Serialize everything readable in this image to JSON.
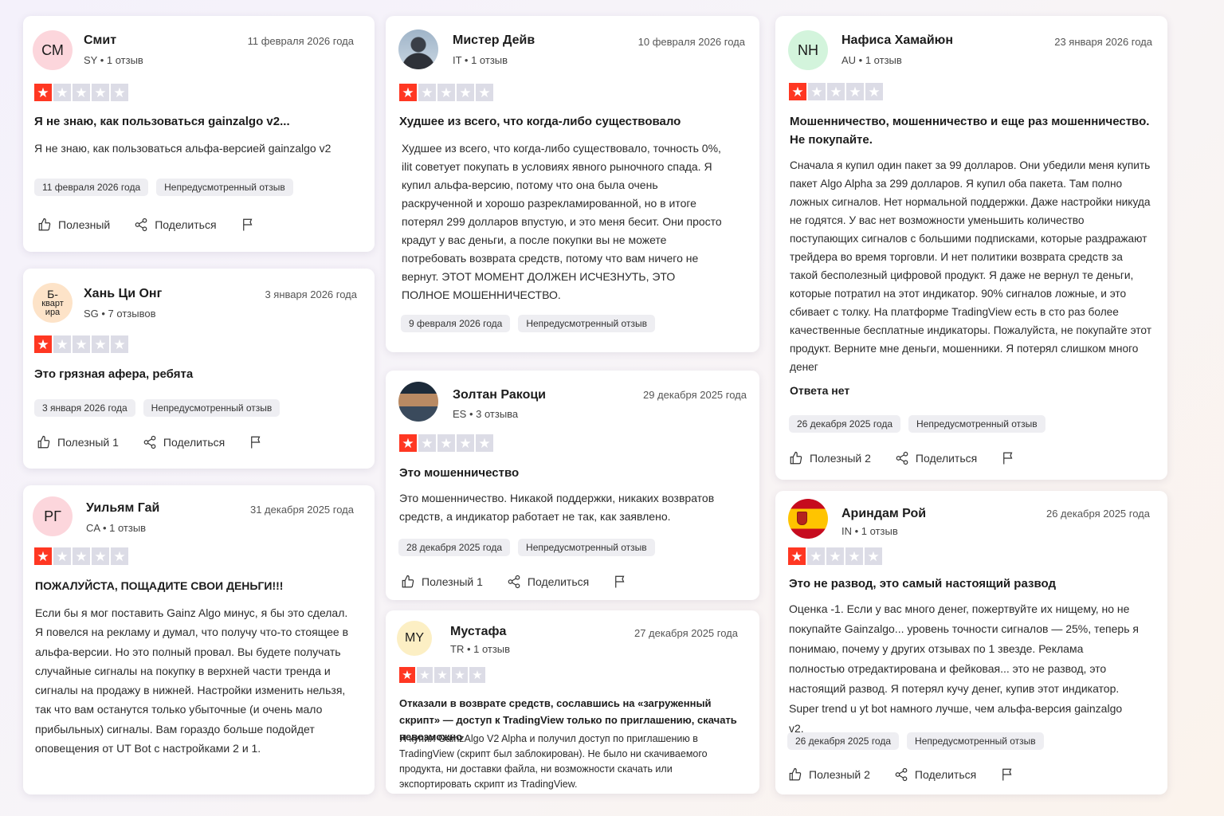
{
  "common": {
    "helpful_label": "Полезный",
    "share_label": "Поделиться",
    "unprompted_tag": "Непредусмотренный отзыв"
  },
  "colors": {
    "star_on": "#ff3722",
    "star_off": "#dcdce6"
  },
  "reviews": [
    {
      "initials": "СМ",
      "name": "Смит",
      "meta": "SY • 1 отзыв",
      "date": "11 февраля 2026 года",
      "rating": 1,
      "title": "Я не знаю, как пользоваться gainzalgo v2...",
      "body": "Я не знаю, как пользоваться альфа-версией gainzalgo v2",
      "tag_date": "11 февраля 2026 года",
      "helpful": "Полезный"
    },
    {
      "initials": "Б-кварт ира",
      "initials_lines": [
        "Б-",
        "кварт",
        "ира"
      ],
      "name": "Хань Ци Онг",
      "meta": "SG • 7 отзывов",
      "date": "3 января 2026 года",
      "rating": 1,
      "title": "Это грязная афера, ребята",
      "body": "",
      "tag_date": "3 января 2026 года",
      "helpful": "Полезный 1"
    },
    {
      "initials": "РГ",
      "name": "Уильям Гай",
      "meta": "CA • 1 отзыв",
      "date": "31 декабря 2025 года",
      "rating": 1,
      "title": "ПОЖАЛУЙСТА, ПОЩАДИТЕ СВОИ ДЕНЬГИ!!!",
      "body": "Если бы я мог поставить Gainz Algo минус, я бы это сделал. Я повелся на рекламу и думал, что получу что-то стоящее в альфа-версии. Но это полный провал. Вы будете получать случайные сигналы на покупку в верхней части тренда и сигналы на продажу в нижней. Настройки изменить нельзя, так что вам останутся только убыточные (и очень мало прибыльных) сигналы. Вам гораздо больше подойдет оповещения от UT Bot с настройками 2 и 1."
    },
    {
      "avatar": "photo-avatar",
      "name": "Мистер Дейв",
      "meta": "IT • 1 отзыв",
      "date": "10 февраля 2026 года",
      "rating": 1,
      "title": "Худшее из всего, что когда-либо существовало",
      "body": "Худшее из всего, что когда-либо существовало, точность 0%, ilit советует покупать в условиях явного рыночного спада. Я купил альфа-версию, потому что она была очень раскрученной и хорошо разрекламированной, но в итоге потерял 299 долларов впустую, и это меня бесит. Они просто крадут у вас деньги, а после покупки вы не можете потребовать возврата средств, потому что вам ничего не вернут. ЭТОТ МОМЕНТ ДОЛЖЕН ИСЧЕЗНУТЬ, ЭТО ПОЛНОЕ МОШЕННИЧЕСТВО.",
      "tag_date": "9 февраля 2026 года"
    },
    {
      "avatar": "photo-avatar",
      "name": "Золтан Ракоци",
      "meta": "ES • 3 отзыва",
      "date": "29 декабря 2025 года",
      "rating": 1,
      "title": "Это мошенничество",
      "body": "Это мошенничество. Никакой поддержки, никаких возвратов средств, а индикатор работает не так, как заявлено.",
      "tag_date": "28 декабря 2025 года",
      "helpful": "Полезный 1"
    },
    {
      "initials": "MY",
      "name": "Мустафа",
      "meta": "TR • 1 отзыв",
      "date": "27 декабря 2025 года",
      "rating": 1,
      "title": "Отказали в возврате средств, сославшись на «загруженный скрипт» — доступ к TradingView только по приглашению, скачать невозможно",
      "body": "Я купил GainzAlgo V2 Alpha и получил доступ по приглашению в TradingView (скрипт был заблокирован). Не было ни скачиваемого продукта, ни доставки файла, ни возможности скачать или экспортировать скрипт из TradingView."
    },
    {
      "initials": "NH",
      "name": "Нафиса Хамайюн",
      "meta": "AU • 1 отзыв",
      "date": "23 января 2026 года",
      "rating": 1,
      "title": "Мошенничество, мошенничество и еще раз мошенничество. Не покупайте.",
      "body": "Сначала я купил один пакет за 99 долларов. Они убедили меня купить пакет Algo Alpha за 299 долларов. Я купил оба пакета. Там полно ложных сигналов. Нет нормальной поддержки. Даже настройки никуда не годятся. У вас нет возможности уменьшить количество поступающих сигналов с большими подписками, которые раздражают трейдера во время торговли. И нет политики возврата средств за такой бесполезный цифровой продукт. Я даже не вернул те деньги, которые потратил на этот индикатор. 90% сигналов ложные, и это сбивает с толку. На платформе TradingView есть в сто раз более качественные бесплатные индикаторы. Пожалуйста, не покупайте этот продукт. Верните мне деньги, мошенники. Я потерял слишком много денег",
      "no_reply": "Ответа нет",
      "tag_date": "26 декабря 2025 года",
      "helpful": "Полезный 2"
    },
    {
      "avatar": "spain-flag-avatar",
      "name": "Ариндам Рой",
      "meta": "IN • 1 отзыв",
      "date": "26 декабря 2025 года",
      "rating": 1,
      "title": "Это не развод, это самый настоящий развод",
      "body": "Оценка -1. Если у вас много денег, пожертвуйте их нищему, но не покупайте Gainzalgo... уровень точности сигналов — 25%, теперь я понимаю, почему у других отзывах по 1 звезде. Реклама полностью отредактирована и фейковая... это не развод, это настоящий развод. Я потерял кучу денег, купив этот индикатор. Super trend u yt bot намного лучше, чем альфа-версия gainzalgo v2.",
      "tag_date": "26 декабря 2025 года",
      "helpful": "Полезный 2"
    }
  ]
}
